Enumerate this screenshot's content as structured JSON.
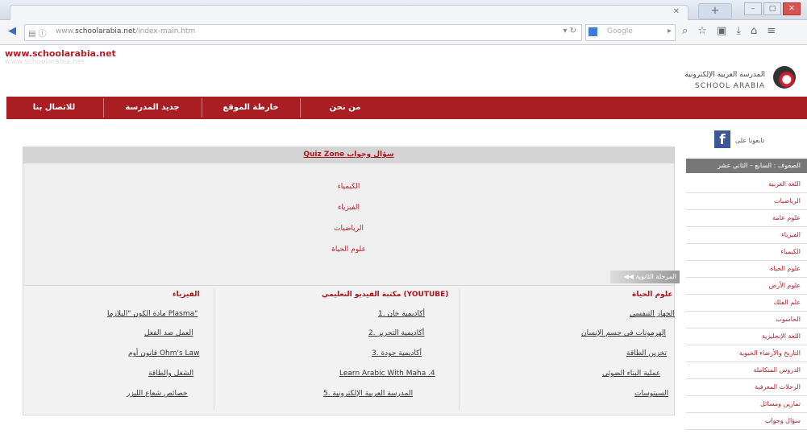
{
  "browser": {
    "address": {
      "scheme": "www.",
      "host": "schoolarabia.net",
      "path": "/index-main.htm"
    },
    "search_placeholder": "Google"
  },
  "site": {
    "url_text": "www.schoolarabia.net",
    "url_shadow": "www.schoolarabia.net",
    "logo_arabic": "المدرسة العربية الإلكترونية",
    "logo_english": "SCHOOL ARABIA"
  },
  "menu": [
    "للاتصال بنا",
    "جديد المدرسة",
    "خارطة الموقع",
    "من نحن"
  ],
  "facebook": {
    "label": "تابعونا على"
  },
  "sidebar": {
    "heading": "الصفوف : السابع – الثاني عشر",
    "items": [
      "اللغة العربية",
      "الرياضيات",
      "علوم عامة",
      "الفيزياء",
      "الكيمياء",
      "علوم الحياة",
      "علوم الأرض",
      "علم الفلك",
      "الحاسوب",
      "اللغة الإنجليزية",
      "التاريخ والأرضاء الحيوية",
      "الدروس المتكاملة",
      "الرحلات المعرفية",
      "تمارين ومسائل",
      "سؤال وجواب"
    ]
  },
  "quiz": {
    "title": "Quiz Zone سؤال وجواب",
    "links": [
      "الكيمياء",
      "الفيزياء",
      "الرياضيات",
      "علوم الحياة"
    ]
  },
  "secondary": {
    "tag": "المرحلة الثانوية",
    "columns": [
      {
        "heading": "علوم الحياة",
        "rows": [
          "الجهاز التنفسي",
          "الهرمونات في جسم الإنسان",
          "تخزين الطاقة",
          "عملية البناء الضوئي",
          "السيتوسات"
        ]
      },
      {
        "heading": "مكتبة الفيديو التعليمي (YOUTUBE)",
        "rows": [
          "1. أكاديمية خان",
          "2. أكاديمية التحرير",
          "3. أكاديمية جودة",
          "Learn Arabic With Maha .4",
          "5. المدرسة العربية الإلكترونية"
        ]
      },
      {
        "heading": "الفيزياء",
        "rows": [
          "مادة الكون \"البلازما Plasma\"",
          "العمل ضد الفعل",
          "قانون أوم Ohm's Law",
          "الشغل والطاقة",
          "خصائص شعاع الليزر"
        ]
      }
    ]
  }
}
